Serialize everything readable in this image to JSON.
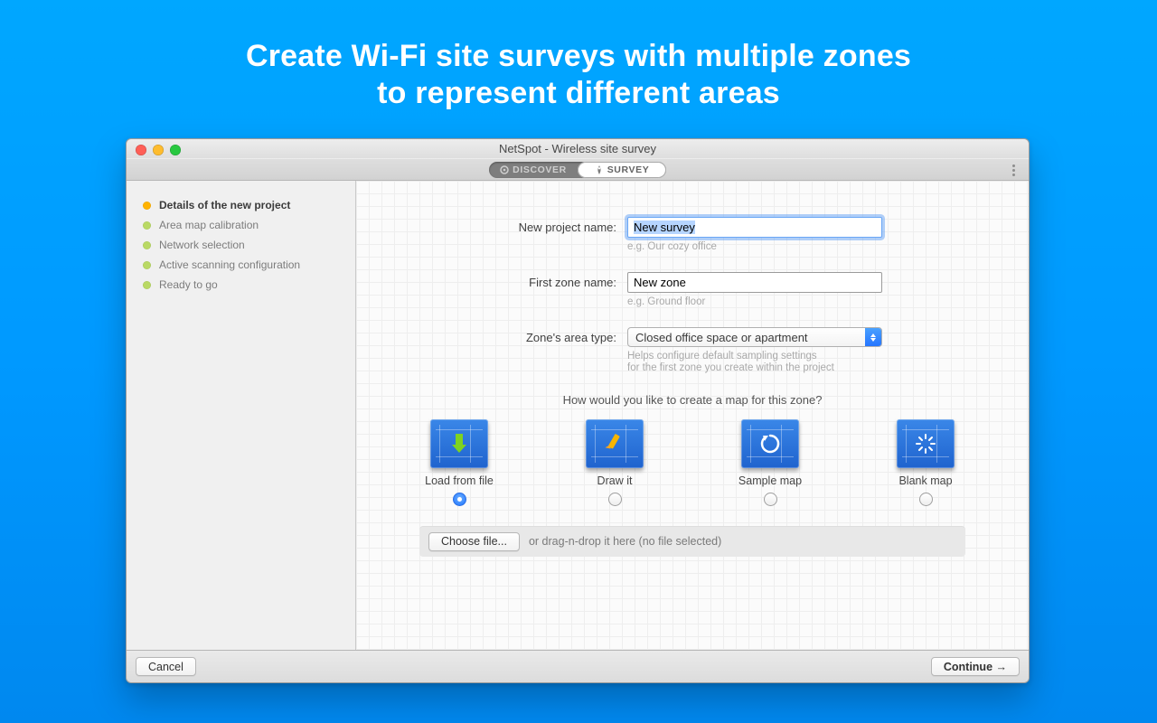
{
  "hero": {
    "line1": "Create Wi-Fi site surveys with multiple zones",
    "line2": "to represent different areas"
  },
  "window": {
    "title": "NetSpot - Wireless site survey"
  },
  "modes": {
    "discover": "DISCOVER",
    "survey": "SURVEY"
  },
  "sidebar": {
    "steps": {
      "details": "Details of the new project",
      "calib": "Area map calibration",
      "network": "Network selection",
      "scan": "Active scanning configuration",
      "ready": "Ready to go"
    }
  },
  "form": {
    "project_label": "New project name:",
    "project_value": "New survey",
    "project_hint": "e.g. Our cozy office",
    "zone_label": "First zone name:",
    "zone_value": "New zone",
    "zone_hint": "e.g. Ground floor",
    "area_label": "Zone's area type:",
    "area_selected": "Closed office space or apartment",
    "area_hint1": "Helps configure default sampling settings",
    "area_hint2": "for the first zone you create within the project",
    "map_prompt": "How would you like to create a map for this zone?",
    "opts": {
      "load": "Load from file",
      "draw": "Draw it",
      "sample": "Sample map",
      "blank": "Blank map"
    },
    "choose_label": "Choose file...",
    "drop_text": "or drag-n-drop it here (no file selected)"
  },
  "footer": {
    "cancel": "Cancel",
    "continue": "Continue →"
  }
}
